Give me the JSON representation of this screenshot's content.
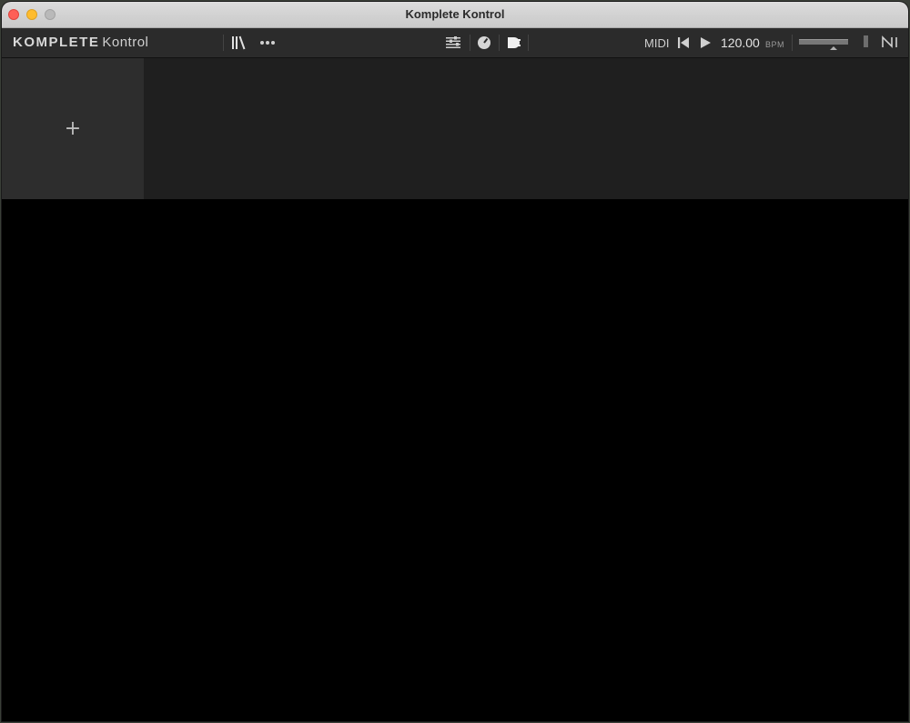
{
  "window": {
    "title": "Komplete Kontrol"
  },
  "toolbar": {
    "brand_bold": "KOMPLETE",
    "brand_light": "Kontrol",
    "icons": {
      "library": "library-icon",
      "more": "more-options-icon",
      "mixer": "mixer-icon",
      "performance": "performance-knob-icon",
      "plugin": "plugin-icon",
      "rewind": "skip-to-start-icon",
      "play": "play-icon",
      "ni_logo": "ni-logo-icon"
    },
    "midi_label": "MIDI",
    "tempo": "120.00",
    "tempo_unit": "BPM",
    "volume_level": 0.7
  },
  "rack": {
    "add_slot_symbol": "+"
  }
}
